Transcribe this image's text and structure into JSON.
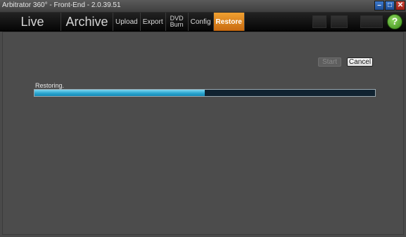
{
  "window": {
    "title": "Arbitrator 360° - Front-End - 2.0.39.51",
    "controls": [
      "minimize-icon",
      "maximize-icon",
      "close-icon"
    ]
  },
  "nav": {
    "live": "Live",
    "archive": "Archive",
    "upload": "Upload",
    "export": "Export",
    "dvd_line1": "DVD",
    "dvd_line2": "Burn",
    "config": "Config",
    "restore": "Restore",
    "help": "?",
    "active_tab": "Restore",
    "active_color": "#e08a20"
  },
  "restore": {
    "start_label": "Start",
    "cancel_label": "Cancel",
    "status_text": "Restoring.",
    "progress": 0.5
  }
}
